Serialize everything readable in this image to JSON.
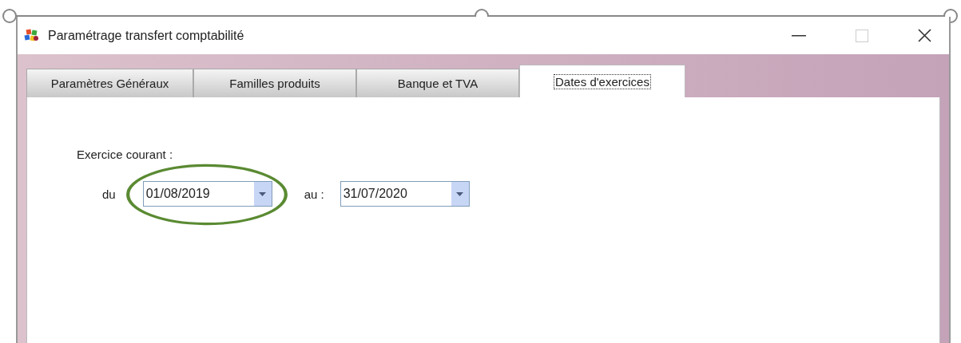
{
  "window": {
    "title": "Paramétrage transfert comptabilité"
  },
  "tabs": [
    {
      "label": "Paramètres Généraux",
      "selected": false
    },
    {
      "label": "Familles produits",
      "selected": false
    },
    {
      "label": "Banque et TVA",
      "selected": false
    },
    {
      "label": "Dates d'exercices",
      "selected": true
    }
  ],
  "group_label": "Exercice courant :",
  "date_fields": [
    {
      "label": "du",
      "value": "01/08/2019",
      "highlighted": true
    },
    {
      "label": "au :",
      "value": "31/07/2020",
      "highlighted": false
    }
  ]
}
